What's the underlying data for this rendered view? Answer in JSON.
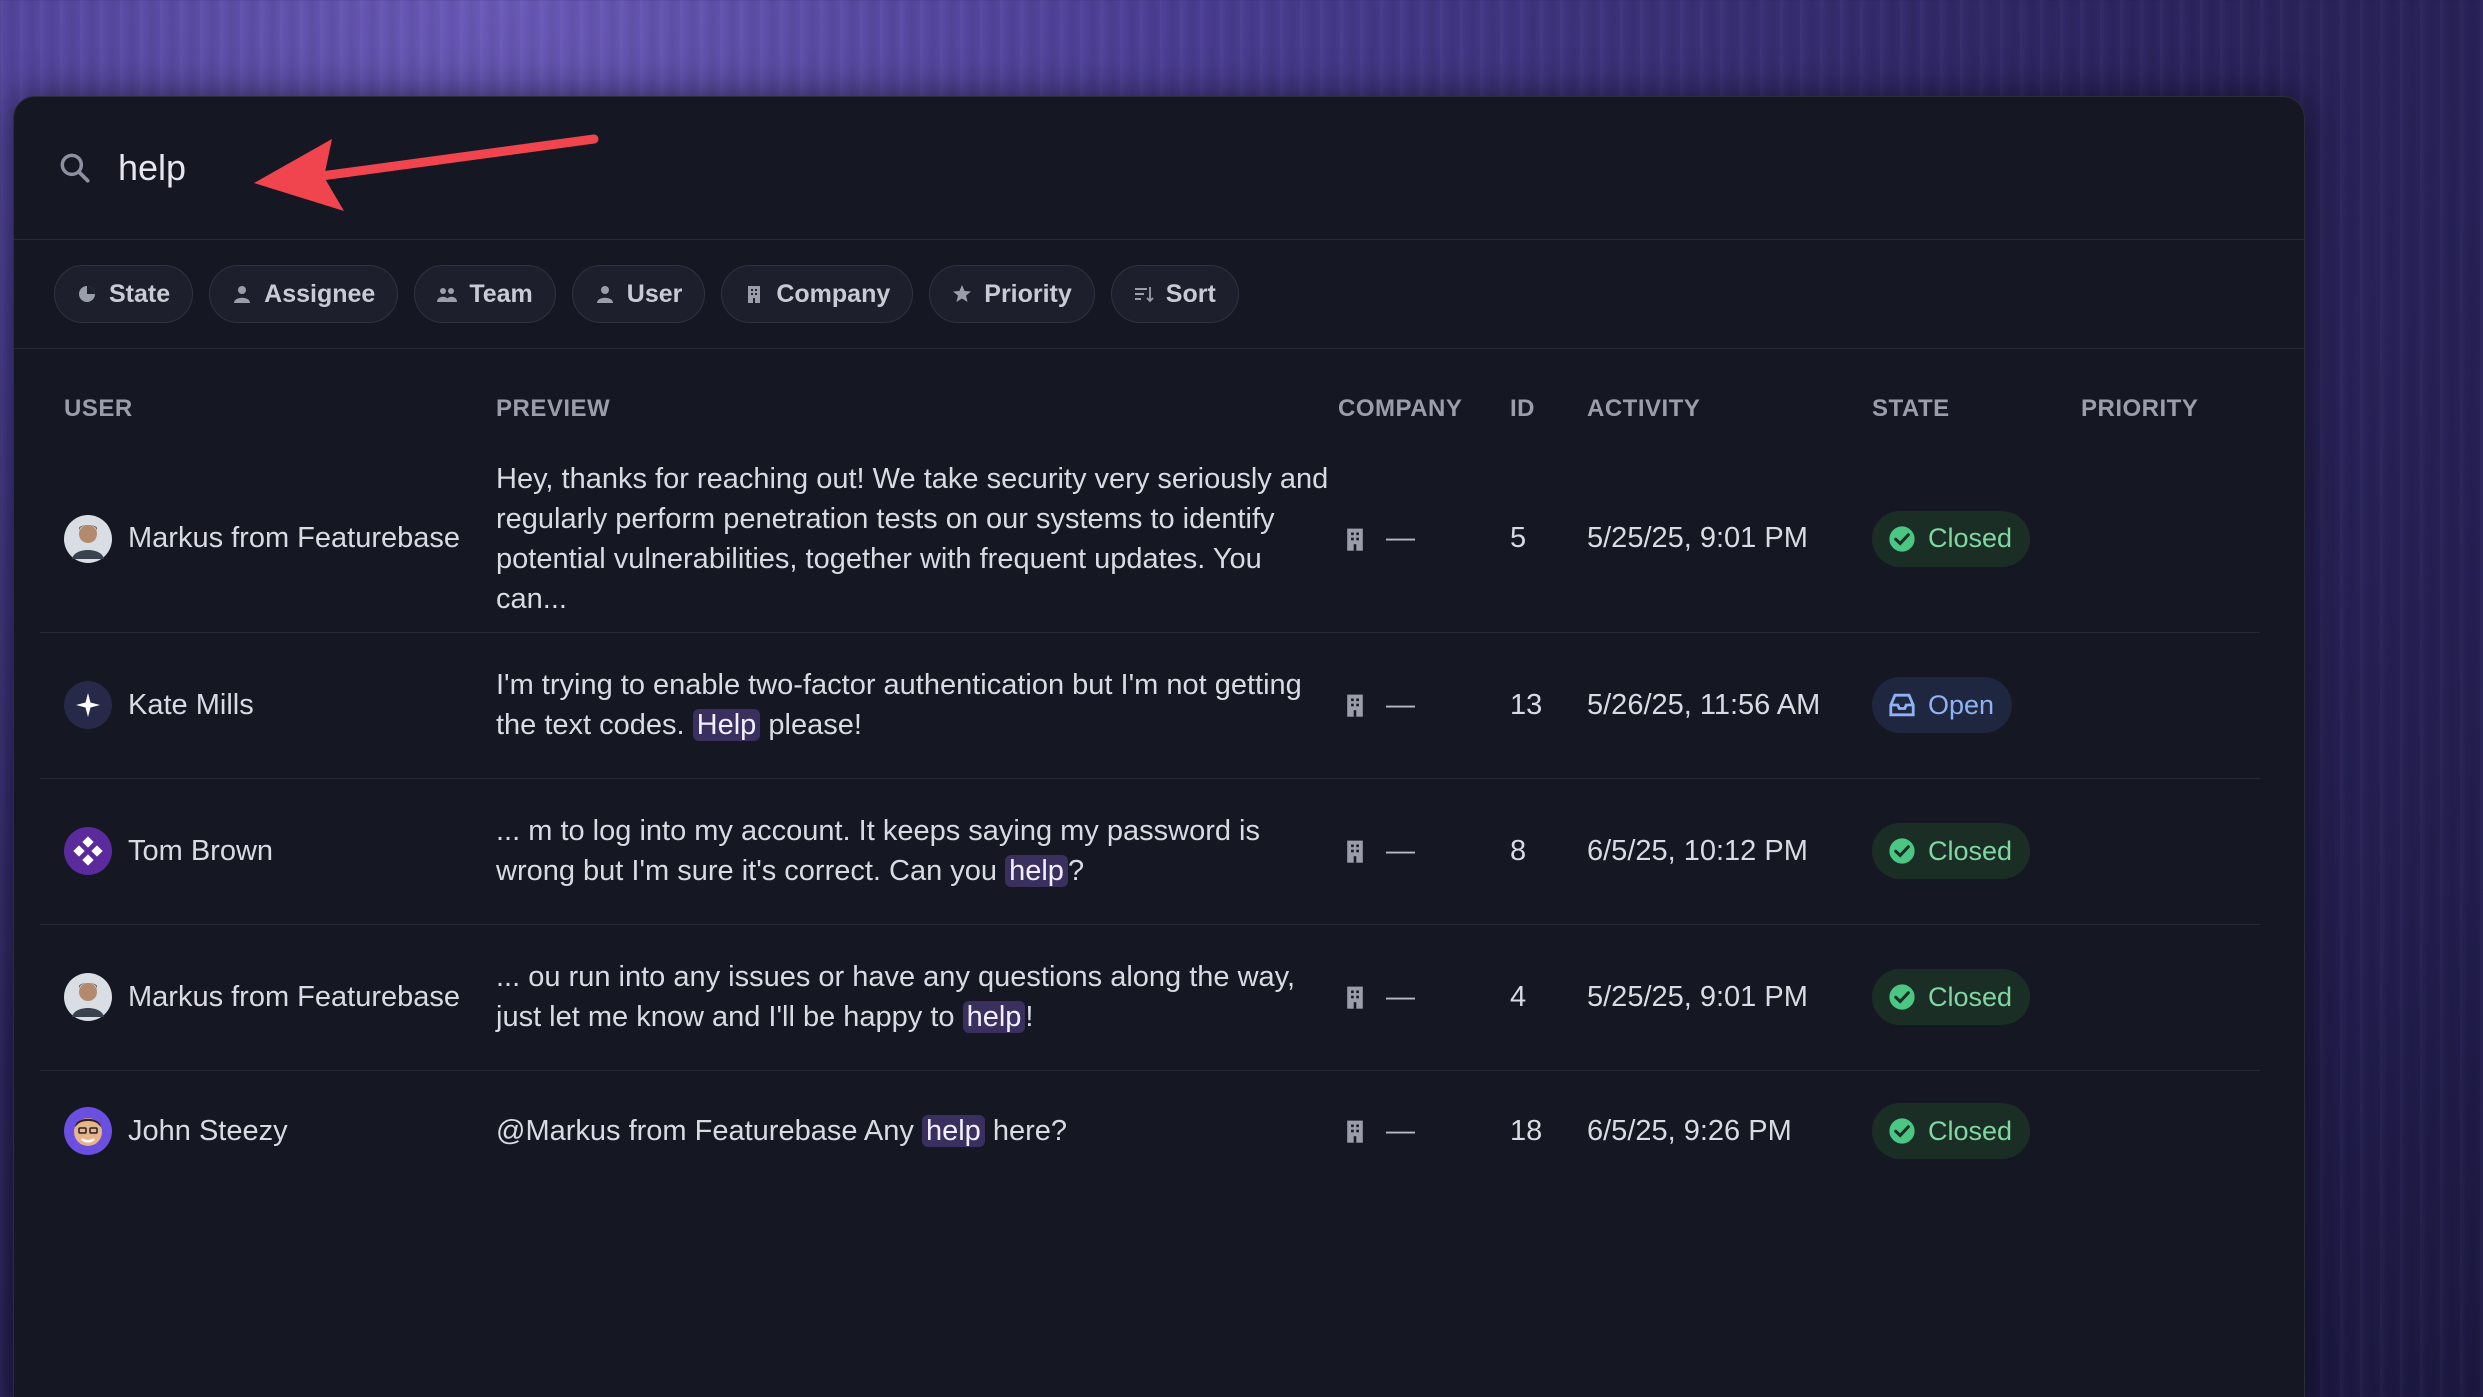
{
  "search": {
    "value": "help"
  },
  "filters": [
    {
      "label": "State",
      "icon": "state-icon"
    },
    {
      "label": "Assignee",
      "icon": "person-icon"
    },
    {
      "label": "Team",
      "icon": "team-icon"
    },
    {
      "label": "User",
      "icon": "person-icon"
    },
    {
      "label": "Company",
      "icon": "building-icon"
    },
    {
      "label": "Priority",
      "icon": "star-icon"
    },
    {
      "label": "Sort",
      "icon": "sort-icon"
    }
  ],
  "columns": {
    "user": "USER",
    "preview": "PREVIEW",
    "company": "COMPANY",
    "id": "ID",
    "activity": "ACTIVITY",
    "state": "STATE",
    "priority": "PRIORITY"
  },
  "rows": [
    {
      "user": "Markus from Featurebase",
      "avatar": "person-photo",
      "preview_parts": [
        "Hey, thanks for reaching out!  We take security very seriously and regularly perform penetration tests on our systems to identify potential vulnerabilities, together with frequent updates. You can..."
      ],
      "highlight": "",
      "preview_after": "",
      "company": "—",
      "id": "5",
      "activity": "5/25/25, 9:01 PM",
      "state": "Closed",
      "state_type": "closed",
      "priority": ""
    },
    {
      "user": "Kate Mills",
      "avatar": "sparkle-avatar",
      "preview_before": "I'm trying to enable two-factor authentication but I'm not getting the text codes. ",
      "highlight": "Help",
      "preview_after": " please!",
      "company": "—",
      "id": "13",
      "activity": "5/26/25, 11:56 AM",
      "state": "Open",
      "state_type": "open",
      "priority": ""
    },
    {
      "user": "Tom Brown",
      "avatar": "diamond-avatar",
      "preview_before": "... m to log into my account. It keeps saying my password is wrong but I'm sure it's correct. Can you ",
      "highlight": "help",
      "preview_after": "?",
      "company": "—",
      "id": "8",
      "activity": "6/5/25, 10:12 PM",
      "state": "Closed",
      "state_type": "closed",
      "priority": ""
    },
    {
      "user": "Markus from Featurebase",
      "avatar": "person-photo",
      "preview_before": "... ou run into any issues or have any questions along the way, just let me know and I'll be happy to ",
      "highlight": "help",
      "preview_after": "!",
      "company": "—",
      "id": "4",
      "activity": "5/25/25, 9:01 PM",
      "state": "Closed",
      "state_type": "closed",
      "priority": ""
    },
    {
      "user": "John Steezy",
      "avatar": "memoji-avatar",
      "preview_before": "@Markus from Featurebase Any ",
      "highlight": "help",
      "preview_after": " here?",
      "company": "—",
      "id": "18",
      "activity": "6/5/25, 9:26 PM",
      "state": "Closed",
      "state_type": "closed",
      "priority": ""
    }
  ],
  "colors": {
    "panel_bg": "#151722",
    "closed_badge": "#7fd7a2",
    "open_badge": "#8fb2f5",
    "annotation_arrow": "#f0444e"
  }
}
